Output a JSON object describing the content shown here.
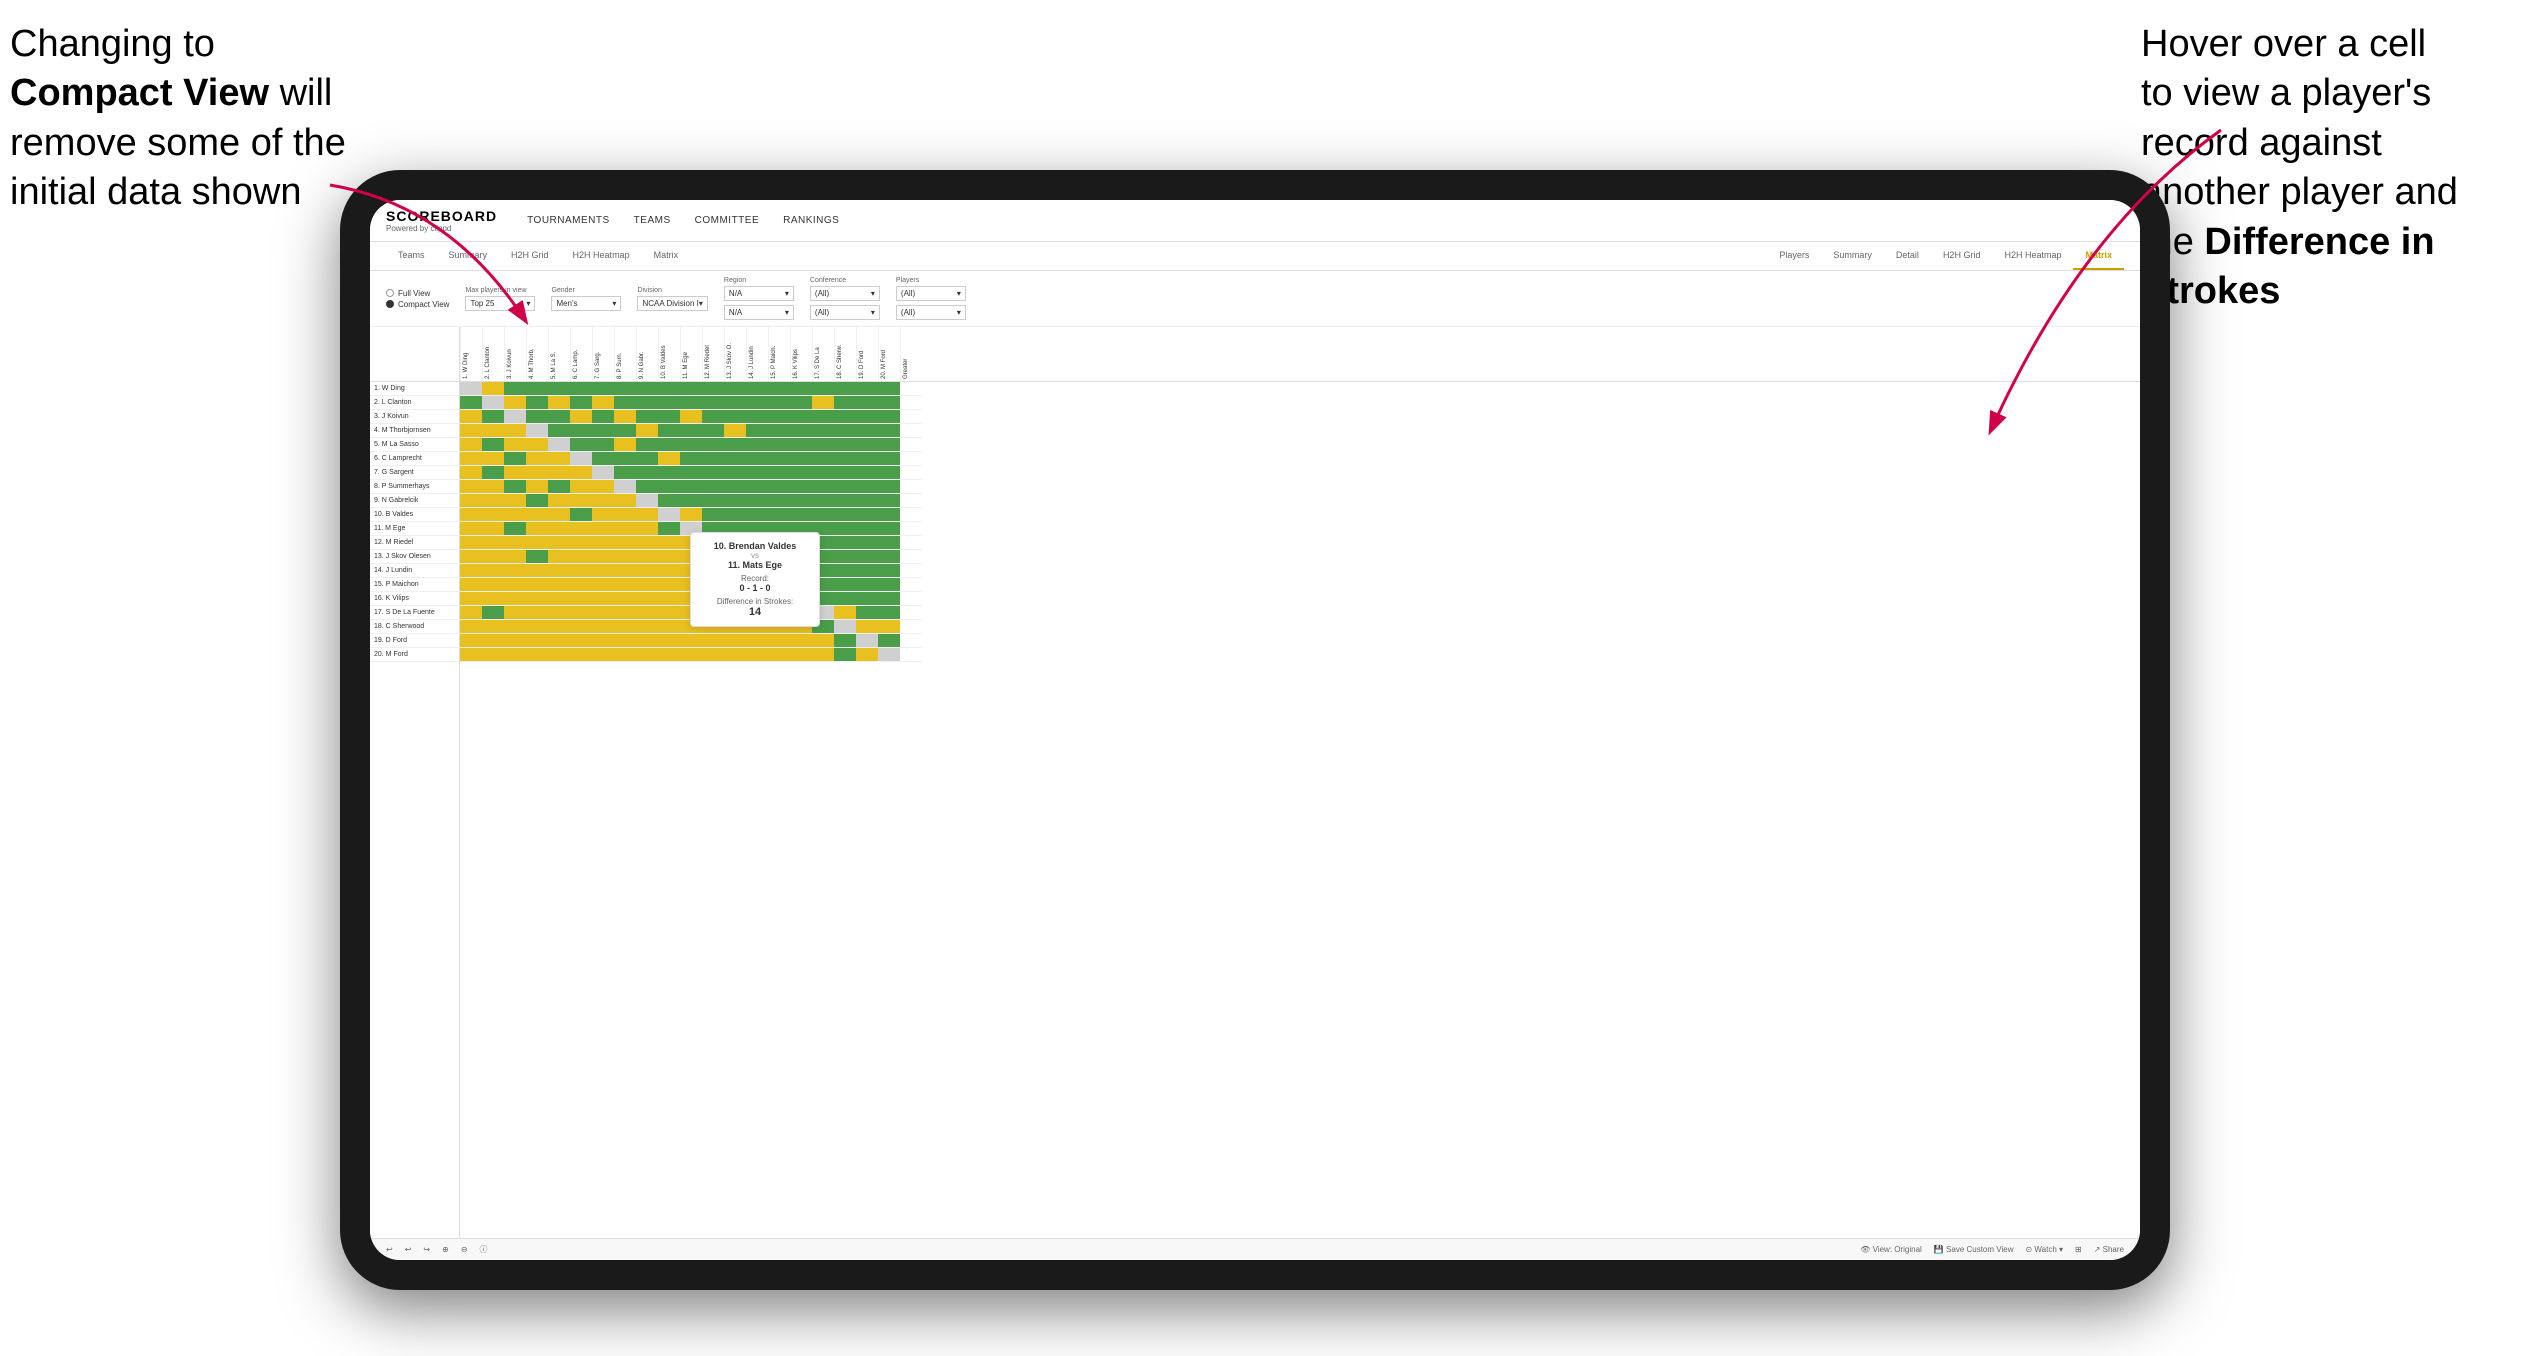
{
  "annotations": {
    "left": {
      "line1": "Changing to",
      "line2bold": "Compact View",
      "line2rest": " will",
      "line3": "remove some of the",
      "line4": "initial data shown"
    },
    "right": {
      "line1": "Hover over a cell",
      "line2": "to view a player's",
      "line3": "record against",
      "line4": "another player and",
      "line5": "the",
      "line5bold": "Difference in",
      "line6bold": "Strokes"
    }
  },
  "app": {
    "logo": "SCOREBOARD",
    "logo_sub": "Powered by clippd",
    "nav": [
      "TOURNAMENTS",
      "TEAMS",
      "COMMITTEE",
      "RANKINGS"
    ],
    "tabs_top": [
      "Teams",
      "Summary",
      "H2H Grid",
      "H2H Heatmap",
      "Matrix"
    ],
    "tabs_players": [
      "Players",
      "Summary",
      "Detail",
      "H2H Grid",
      "H2H Heatmap",
      "Matrix"
    ],
    "active_tab": "Matrix"
  },
  "filters": {
    "view_options": [
      "Full View",
      "Compact View"
    ],
    "selected_view": "Compact View",
    "max_players_label": "Max players in view",
    "max_players_value": "Top 25",
    "gender_label": "Gender",
    "gender_value": "Men's",
    "division_label": "Division",
    "division_value": "NCAA Division I",
    "region_label": "Region",
    "region_value": "N/A",
    "conference_label": "Conference",
    "conference_value": "(All)",
    "players_label": "Players",
    "players_value": "(All)"
  },
  "players": [
    "1. W Ding",
    "2. L Clanton",
    "3. J Koivun",
    "4. M Thorbjornsen",
    "5. M La Sasso",
    "6. C Lamprecht",
    "7. G Sargent",
    "8. P Summerhays",
    "9. N Gabrelcik",
    "10. B Valdes",
    "11. M Ege",
    "12. M Riedel",
    "13. J Skov Olesen",
    "14. J Lundin",
    "15. P Maichon",
    "16. K Vilips",
    "17. S De La Fuente",
    "18. C Sherwood",
    "19. D Ford",
    "20. M Ford"
  ],
  "column_headers": [
    "1. W Ding",
    "2. L Clanton",
    "3. J Koivun",
    "4. M Thorb.",
    "5. M La S.",
    "6. C Lamp.",
    "7. G Sargent",
    "8. P Summer.",
    "9. N Gabr.",
    "10. B Valdes",
    "11. M Ege",
    "12. M Riedel",
    "13. J Skov O.",
    "14. J Lundin",
    "15. P Maich.",
    "16. K Vilips",
    "17. S De La F.",
    "18. C Sherw.",
    "19. D Ford",
    "20. M Ford",
    "Greater"
  ],
  "tooltip": {
    "player1": "10. Brendan Valdes",
    "vs": "vs",
    "player2": "11. Mats Ege",
    "record_label": "Record:",
    "record": "0 - 1 - 0",
    "diff_label": "Difference in Strokes:",
    "diff": "14"
  },
  "toolbar": {
    "undo": "↩",
    "redo": "↪",
    "view_original": "View: Original",
    "save_custom": "Save Custom View",
    "watch": "Watch",
    "share": "Share"
  }
}
